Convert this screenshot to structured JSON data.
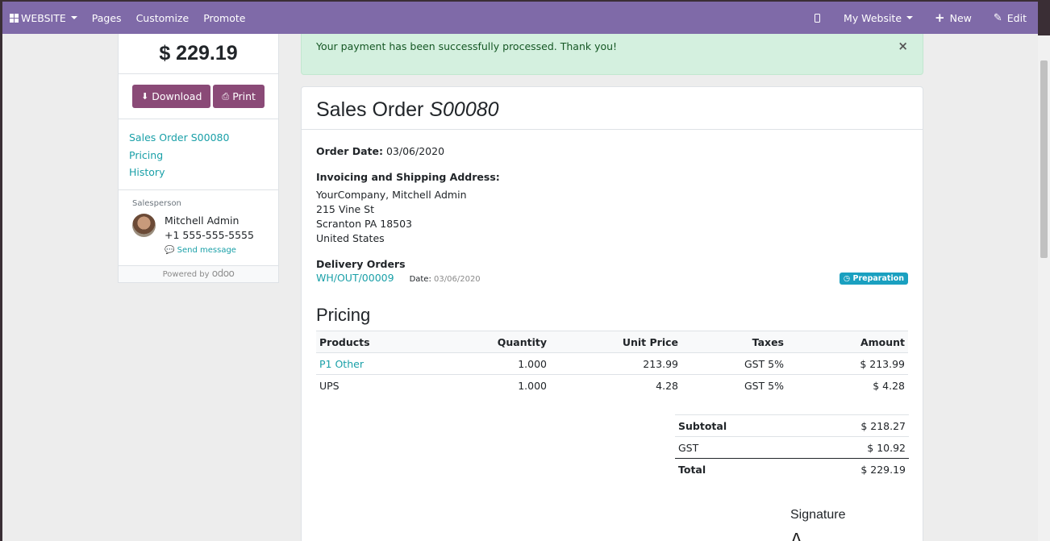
{
  "topbar": {
    "website_label": "WEBSITE",
    "pages_label": "Pages",
    "customize_label": "Customize",
    "promote_label": "Promote",
    "my_website_label": "My Website",
    "new_label": "New",
    "edit_label": "Edit",
    "bg_color": "#7f6aa8"
  },
  "sidebar": {
    "amount": "$ 229.19",
    "download_label": "Download",
    "print_label": "Print",
    "links": [
      "Sales Order S00080",
      "Pricing",
      "History"
    ],
    "salesperson_label": "Salesperson",
    "salesperson_name": "Mitchell Admin",
    "salesperson_phone": "+1 555-555-5555",
    "send_message_label": "Send message",
    "powered_by": "Powered by",
    "odoo_logo": "odoo"
  },
  "alert": {
    "message": "Your payment has been successfully processed. Thank you!",
    "close_symbol": "×"
  },
  "order": {
    "title_prefix": "Sales Order",
    "reference": "S00080",
    "order_date_label": "Order Date:",
    "order_date": "03/06/2020",
    "address_label": "Invoicing and Shipping Address:",
    "address_lines": [
      "YourCompany, Mitchell Admin",
      "215 Vine St",
      "Scranton PA 18503",
      "United States"
    ],
    "delivery_label": "Delivery Orders",
    "delivery_ref": "WH/OUT/00009",
    "delivery_date_label": "Date:",
    "delivery_date": "03/06/2020",
    "delivery_status": "Preparation"
  },
  "pricing": {
    "title": "Pricing",
    "headers": [
      "Products",
      "Quantity",
      "Unit Price",
      "Taxes",
      "Amount"
    ],
    "rows": [
      {
        "product": "P1 Other",
        "quantity": "1.000",
        "unit_price": "213.99",
        "taxes": "GST 5%",
        "amount": "$ 213.99"
      },
      {
        "product": "UPS",
        "quantity": "1.000",
        "unit_price": "4.28",
        "taxes": "GST 5%",
        "amount": "$ 4.28"
      }
    ],
    "subtotal_label": "Subtotal",
    "subtotal": "$ 218.27",
    "tax_label": "GST",
    "tax": "$ 10.92",
    "total_label": "Total",
    "total": "$ 229.19"
  },
  "signature": {
    "title": "Signature"
  }
}
